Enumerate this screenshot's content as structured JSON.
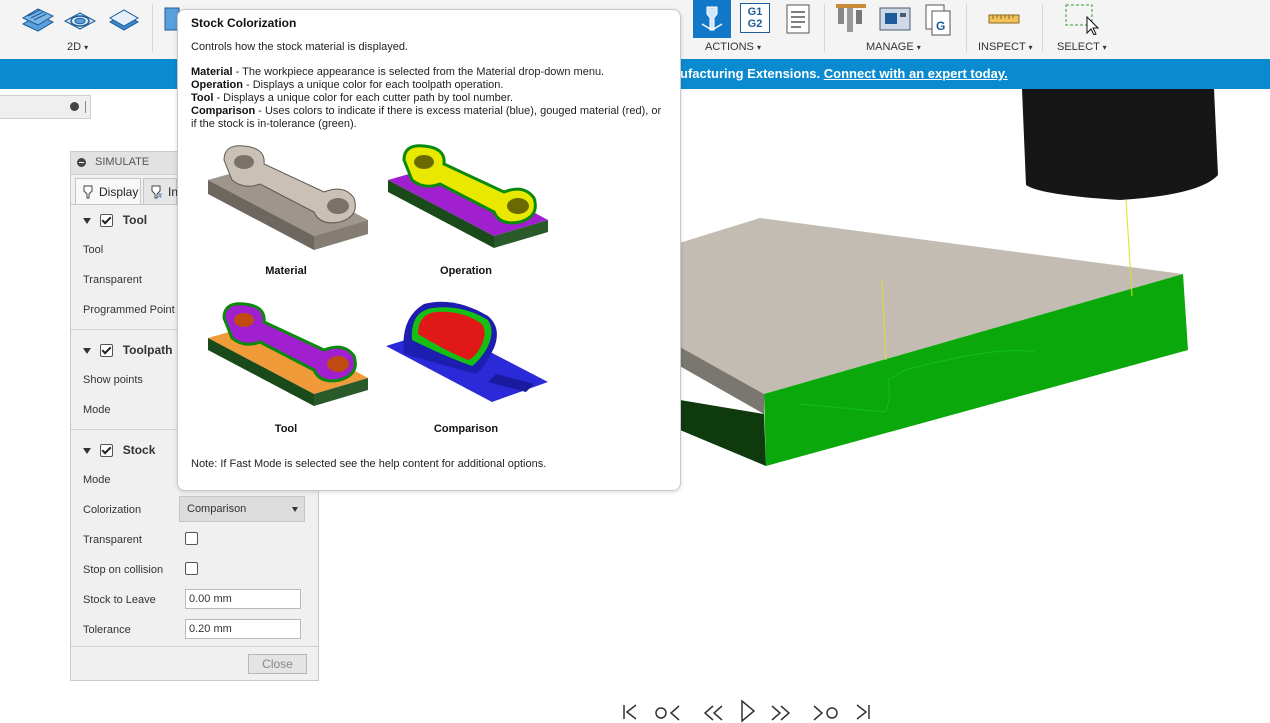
{
  "toolbar": {
    "groups": {
      "2d": "2D",
      "actions": "ACTIONS",
      "manage": "MANAGE",
      "inspect": "INSPECT",
      "select": "SELECT"
    },
    "g1g2_top": "G1",
    "g1g2_bottom": "G2"
  },
  "banner": {
    "text": "ufacturing Extensions.",
    "link": "Connect with an expert today."
  },
  "simulate": {
    "title": "SIMULATE",
    "tabs": [
      "Display",
      "In"
    ],
    "sections": {
      "tool": {
        "title": "Tool",
        "rows": [
          "Tool",
          "Transparent",
          "Programmed Point"
        ]
      },
      "toolpath": {
        "title": "Toolpath",
        "rows": [
          "Show points",
          "Mode"
        ]
      },
      "stock": {
        "title": "Stock",
        "mode_label": "Mode",
        "colorization_label": "Colorization",
        "colorization_value": "Comparison",
        "transparent_label": "Transparent",
        "stop_on_collision_label": "Stop on collision",
        "stock_to_leave_label": "Stock to Leave",
        "stock_to_leave_value": "0.00 mm",
        "tolerance_label": "Tolerance",
        "tolerance_value": "0.20 mm"
      }
    },
    "close_label": "Close"
  },
  "tooltip": {
    "title": "Stock Colorization",
    "description": "Controls how the stock material is displayed.",
    "definitions": [
      {
        "term": "Material",
        "text": " - The workpiece appearance is selected from the Material drop-down menu."
      },
      {
        "term": "Operation",
        "text": " - Displays a unique color for each toolpath operation."
      },
      {
        "term": "Tool",
        "text": " - Displays a unique color for each cutter path by tool number."
      },
      {
        "term": "Comparison",
        "text": " - Uses colors to indicate if there is excess material (blue), gouged material (red), or if the stock is in-tolerance (green)."
      }
    ],
    "captions": {
      "material": "Material",
      "operation": "Operation",
      "tool": "Tool",
      "comparison": "Comparison"
    },
    "note": "Note: If Fast Mode is selected see the help content for additional options."
  },
  "colors": {
    "banner": "#0a8bd0",
    "stock_top": "#c2bcb3",
    "stock_green": "#0aa80a",
    "excess_blue": "#2a2ad8",
    "gouge_red": "#e01818",
    "operation_purple": "#a020d0",
    "operation_yellow": "#e8e800"
  },
  "playback_icons": [
    "first-icon",
    "prev-op-icon",
    "step-back-icon",
    "play-icon",
    "step-forward-icon",
    "next-op-icon",
    "last-icon"
  ]
}
